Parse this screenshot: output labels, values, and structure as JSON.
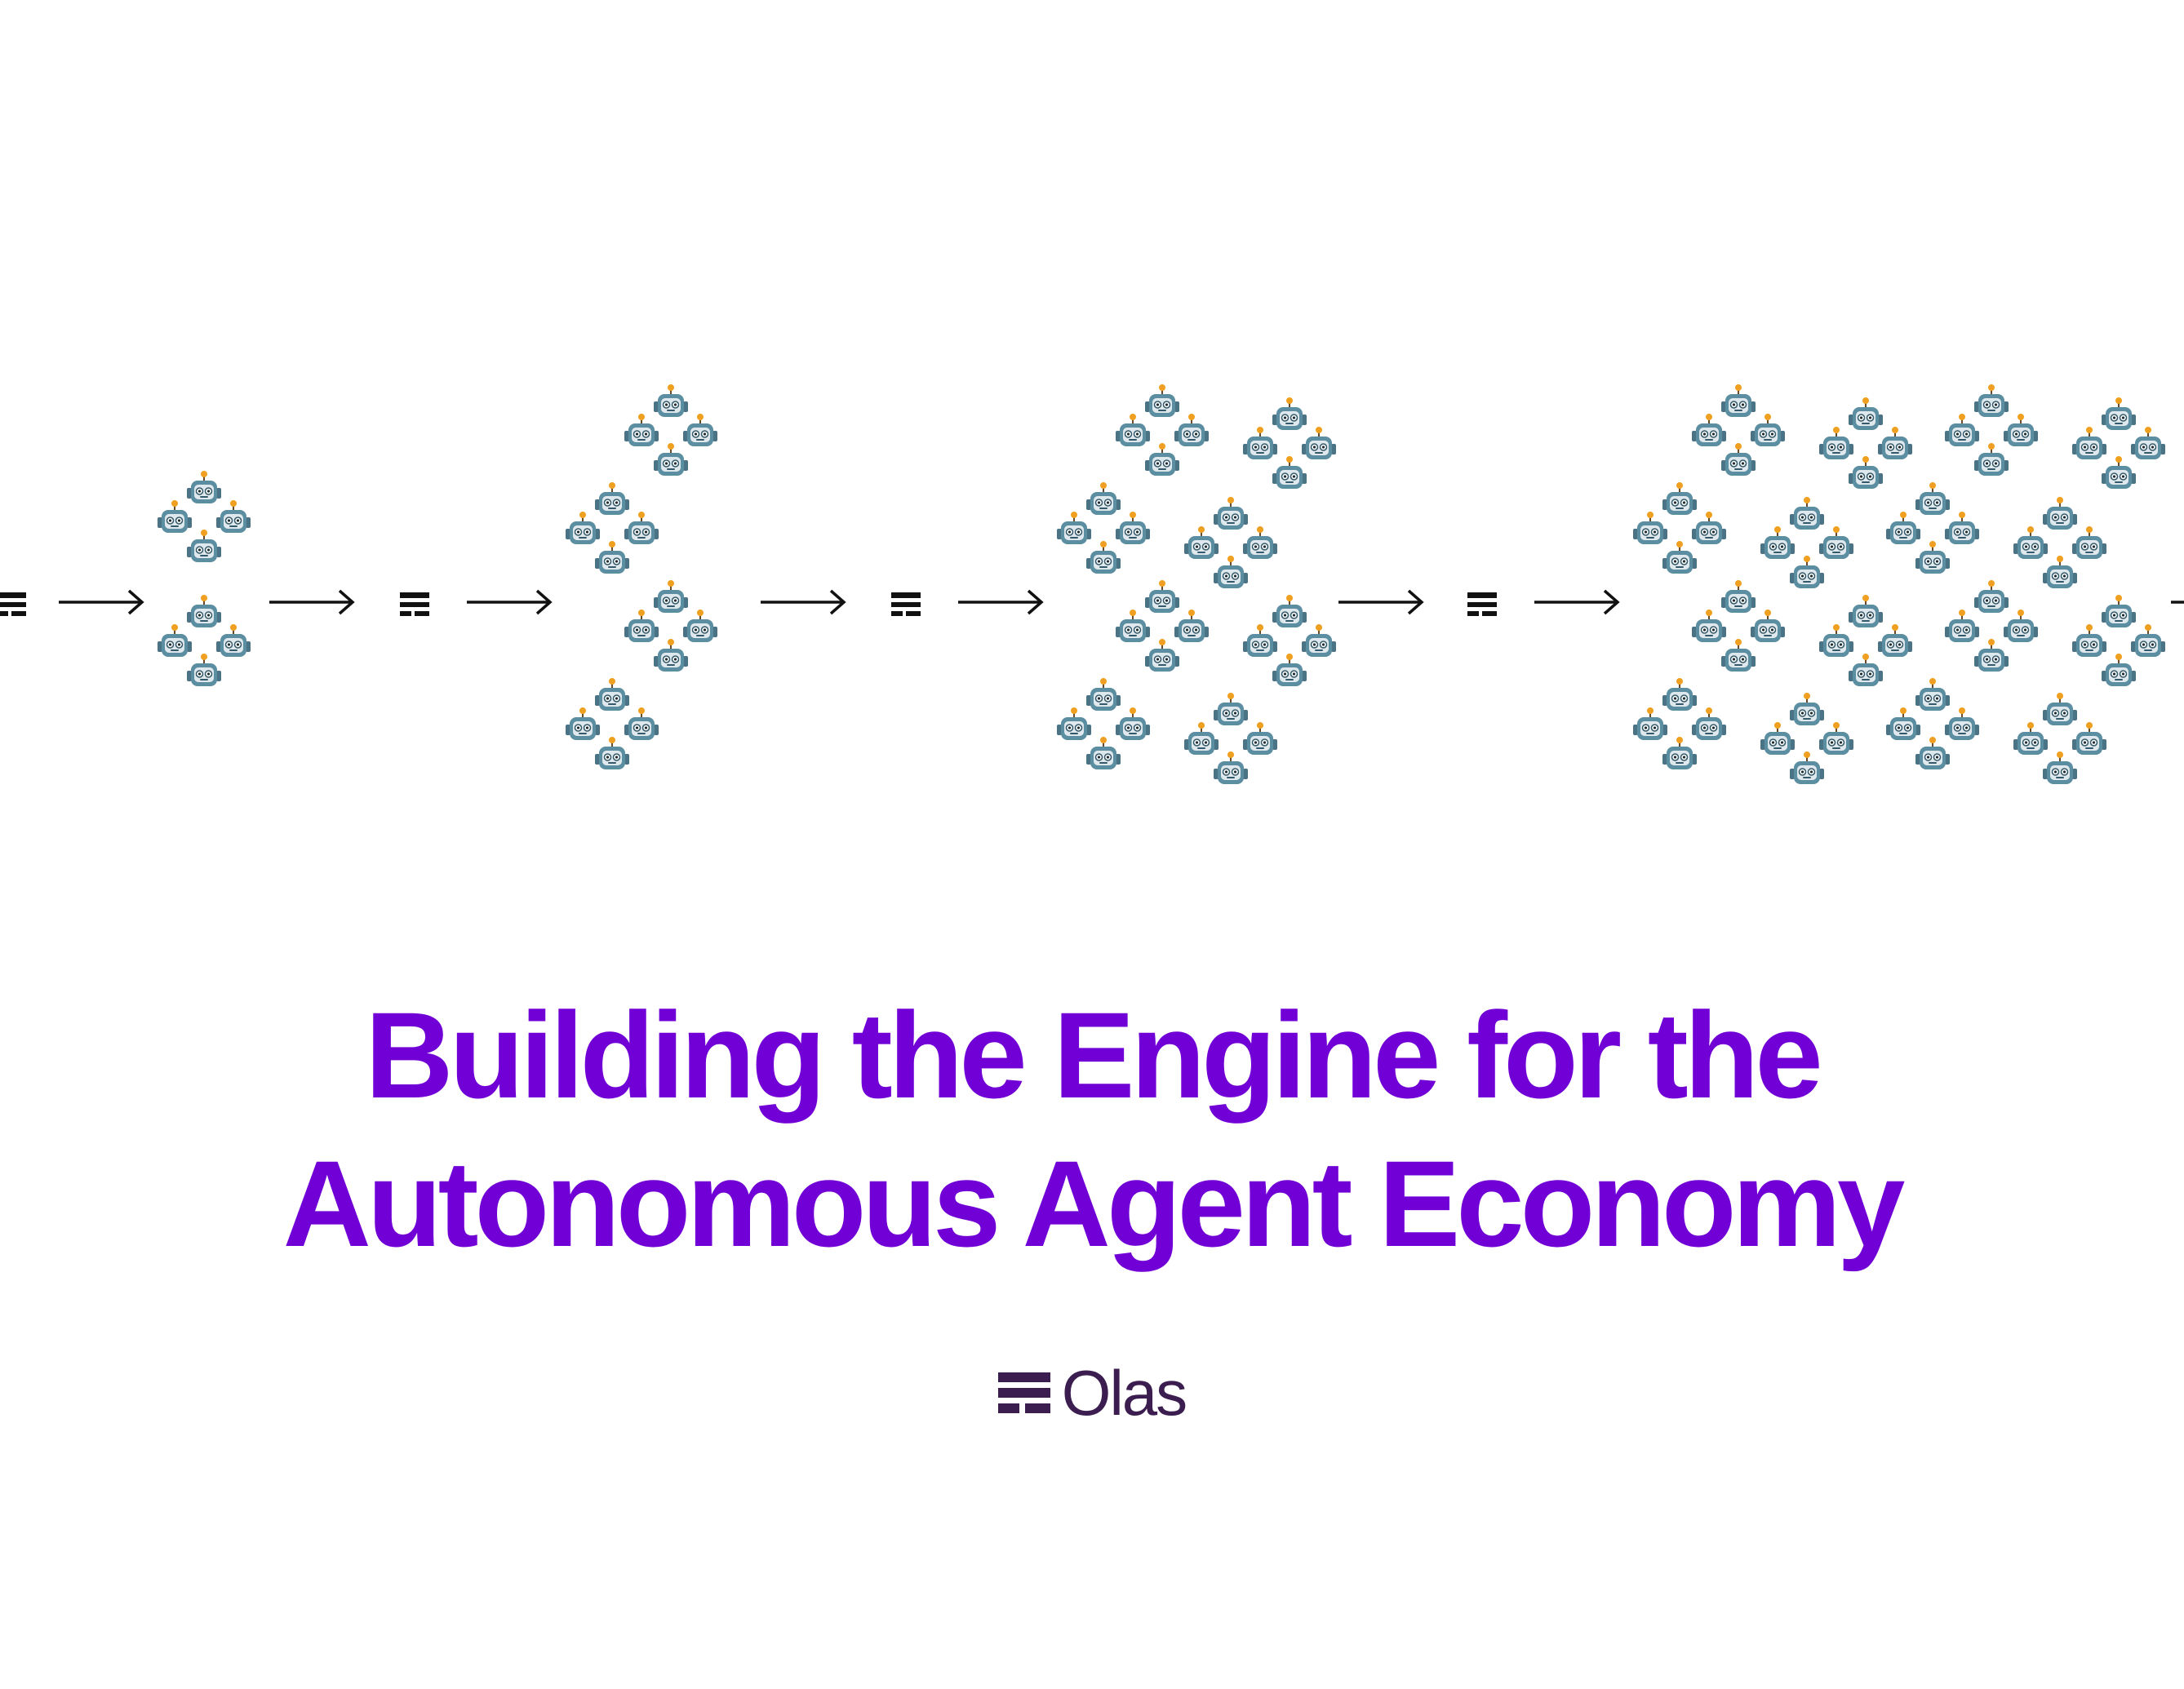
{
  "headline": {
    "line1": "Building the Engine for the",
    "line2": "Autonomous Agent Economy"
  },
  "brand": {
    "name": "Olas",
    "icon": "olas-logo-icon"
  },
  "diagram": {
    "flow": [
      "protocol-icon",
      "arrow-icon",
      "agent-group",
      "arrow-icon",
      "protocol-icon",
      "arrow-icon",
      "agent-group",
      "arrow-icon",
      "protocol-icon",
      "arrow-icon",
      "agent-group",
      "arrow-icon",
      "protocol-icon",
      "arrow-icon",
      "agent-group",
      "arrow-icon"
    ],
    "agent_icon": "robot-icon",
    "stages": [
      {
        "stage": 1,
        "clusters": 2
      },
      {
        "stage": 2,
        "clusters": 4
      },
      {
        "stage": 3,
        "clusters": 8
      },
      {
        "stage": 4,
        "clusters": 16
      }
    ]
  },
  "colors": {
    "headline": "#7100d6",
    "brand": "#3b1e4f",
    "diagram": "#111111",
    "robot_body": "#5c8ea1",
    "robot_face": "#dfe8ec",
    "robot_antenna": "#f0a020"
  }
}
